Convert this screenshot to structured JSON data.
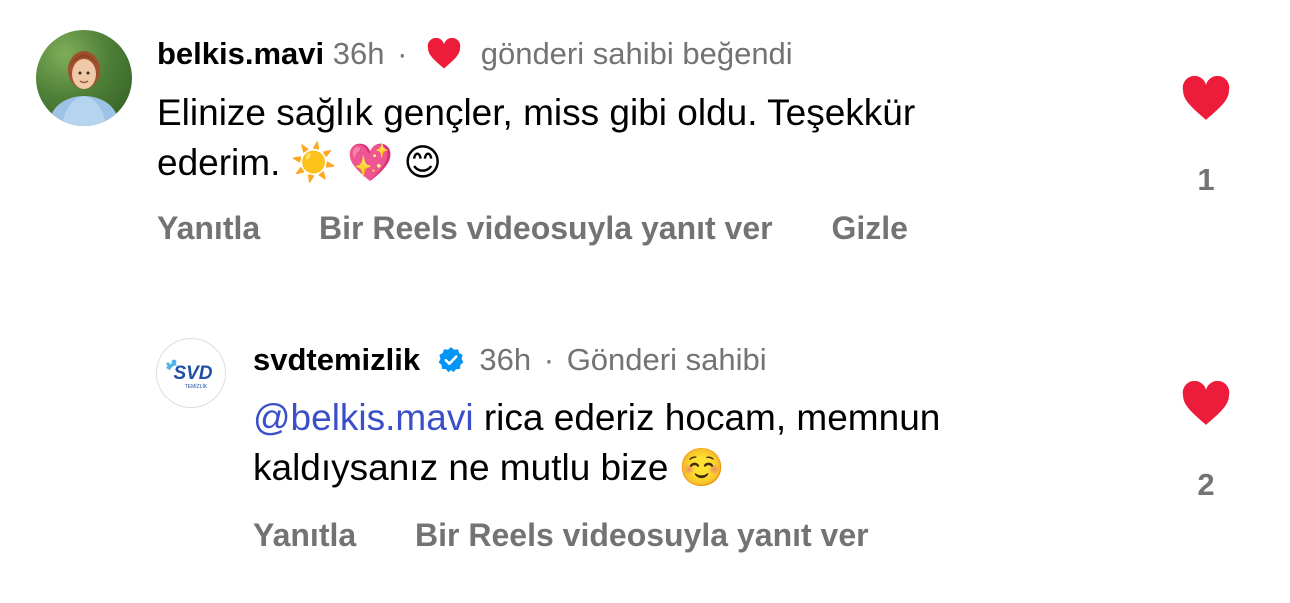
{
  "colors": {
    "heart": "#ed1c3a",
    "meta": "#737373",
    "mention": "#3b50c8",
    "verified": "#0095f6",
    "brand": "#1f4fa3"
  },
  "comments": [
    {
      "username": "belkis.mavi",
      "time": "36h",
      "separator": "·",
      "liked_by_author_text": "gönderi sahibi beğendi",
      "liked_icon": "heart-icon",
      "avatar": "profile-photo",
      "text_line1": "Elinize sağlık gençler, miss gibi oldu. Teşekkür",
      "text_line2": "ederim.",
      "emojis": [
        "☀️",
        "💖",
        "😊"
      ],
      "actions": {
        "reply": "Yanıtla",
        "reels_reply": "Bir Reels videosuyla yanıt ver",
        "hide": "Gizle"
      },
      "like_icon": "heart-icon",
      "like_count": "1"
    },
    {
      "username": "svdtemizlik",
      "verified_icon": "verified-badge-icon",
      "time": "36h",
      "separator": "·",
      "role_label": "Gönderi sahibi",
      "avatar": "svd-logo",
      "avatar_logo_text": "SVD",
      "avatar_logo_subtext": "TEMİZLİK",
      "mention": "@belkis.mavi",
      "text_line1": " rica ederiz hocam, memnun",
      "text_line2": "kaldıysanız ne mutlu bize",
      "emojis": [
        "☺️"
      ],
      "actions": {
        "reply": "Yanıtla",
        "reels_reply": "Bir Reels videosuyla yanıt ver"
      },
      "like_icon": "heart-icon",
      "like_count": "2"
    }
  ]
}
